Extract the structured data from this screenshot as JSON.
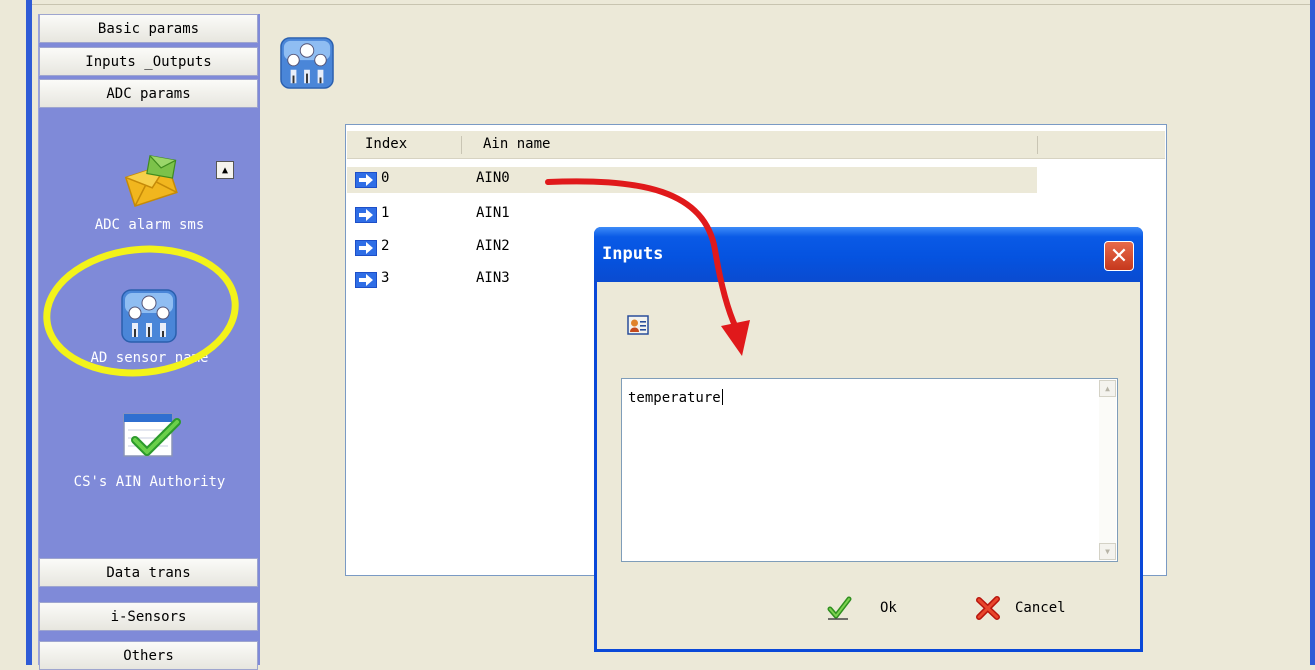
{
  "sidebar": {
    "top_buttons": [
      "Basic params",
      "Inputs _Outputs",
      "ADC params"
    ],
    "items": [
      {
        "label": "ADC alarm sms",
        "icon": "envelope-icon"
      },
      {
        "label": "AD sensor name",
        "icon": "ad-sensor-icon"
      },
      {
        "label": "CS's AIN Authority",
        "icon": "checkmark-calendar-icon"
      }
    ],
    "bottom_buttons": [
      "Data trans",
      "i-Sensors",
      "Others"
    ]
  },
  "list": {
    "columns": [
      "Index",
      "Ain name"
    ],
    "rows": [
      {
        "index": "0",
        "name": "AIN0"
      },
      {
        "index": "1",
        "name": "AIN1"
      },
      {
        "index": "2",
        "name": "AIN2"
      },
      {
        "index": "3",
        "name": "AIN3"
      }
    ],
    "selected_index": 0
  },
  "dialog": {
    "title": "Inputs",
    "text_value": "temperature",
    "ok_label": "Ok",
    "cancel_label": "Cancel"
  },
  "colors": {
    "sidebar_bg": "#7f8ad8",
    "highlight_ring": "#f3f31a",
    "annotation_arrow": "#e0191b",
    "titlebar_blue": "#0553e0"
  }
}
